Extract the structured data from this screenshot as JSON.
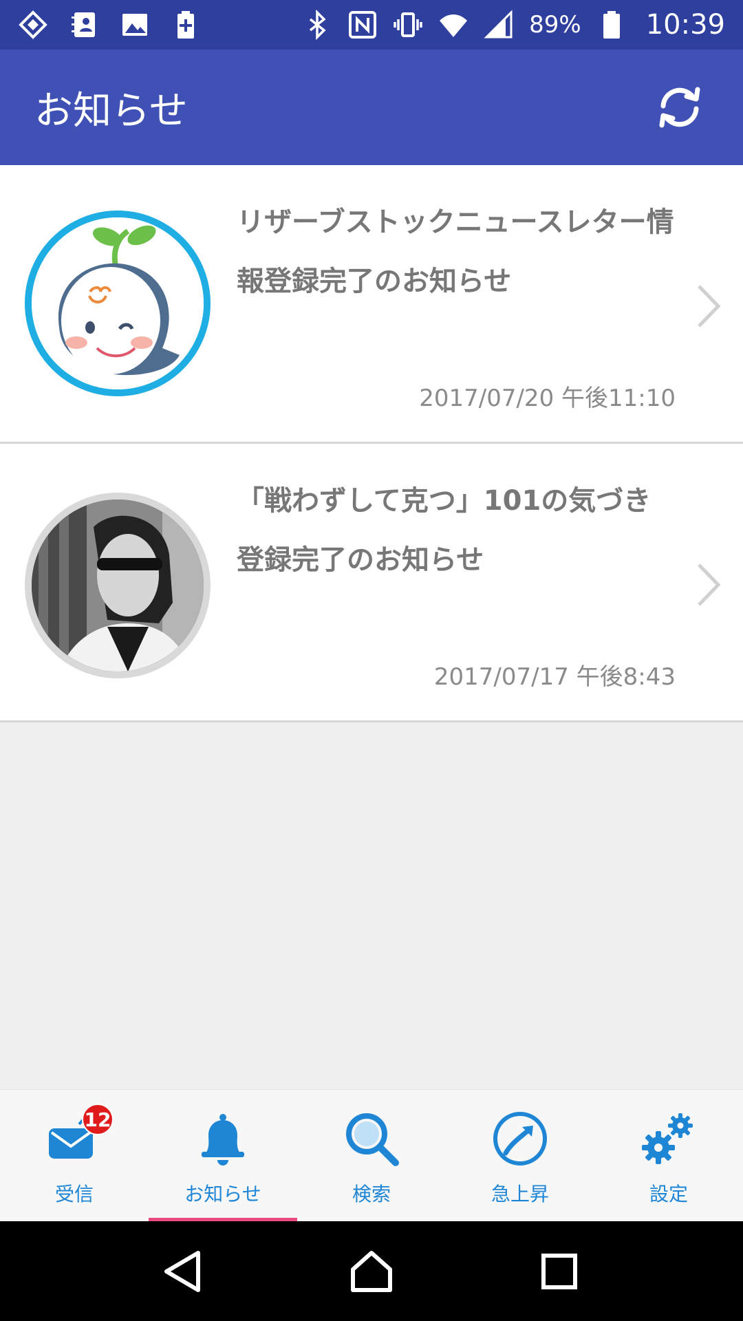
{
  "status_bar": {
    "left_icons": [
      "diamond-app-icon",
      "contacts-icon",
      "image-icon",
      "battery-saver-icon"
    ],
    "right_icons": [
      "bluetooth-icon",
      "nfc-icon",
      "vibrate-icon",
      "wifi-icon",
      "signal-icon"
    ],
    "battery_percent": "89%",
    "time": "10:39"
  },
  "app_bar": {
    "title": "お知らせ",
    "refresh_icon": "refresh-icon"
  },
  "notifications": [
    {
      "title": "リザーブストックニュースレター情報登録完了のお知らせ",
      "date": "2017/07/20 午後11:10",
      "avatar": "mascot-avatar"
    },
    {
      "title": "「戦わずして克つ」101の気づき登録完了のお知らせ",
      "date": "2017/07/17 午後8:43",
      "avatar": "person-photo-avatar"
    }
  ],
  "tabs": [
    {
      "label": "受信",
      "icon": "mail-icon",
      "badge": "12"
    },
    {
      "label": "お知らせ",
      "icon": "bell-icon"
    },
    {
      "label": "検索",
      "icon": "search-icon"
    },
    {
      "label": "急上昇",
      "icon": "trending-icon"
    },
    {
      "label": "設定",
      "icon": "gears-icon"
    }
  ],
  "active_tab_index": 1,
  "colors": {
    "status_bar": "#2f3f9e",
    "app_bar": "#3f51b5",
    "tab_accent": "#1f86d6",
    "active_indicator": "#e8497f",
    "badge": "#e01b1b"
  }
}
